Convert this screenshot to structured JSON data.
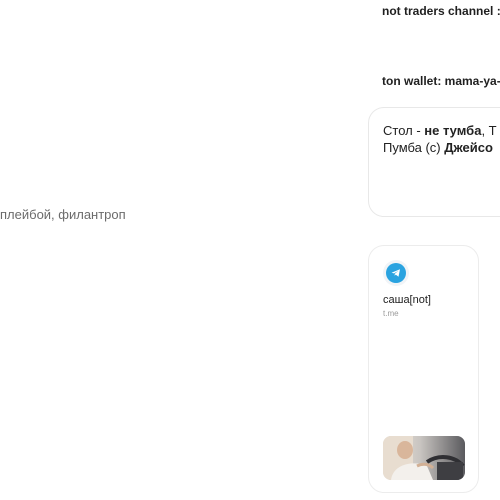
{
  "left": {
    "bio_text": "плейбой, филантроп"
  },
  "right": {
    "line_1": "not traders channel :",
    "line_2": "ton wallet: mama-ya-",
    "quote": {
      "l1_a": "Стол - ",
      "l1_b": "не тумба",
      "l1_c": ", Т",
      "l2_a": "Пумба (с) ",
      "l2_b": "Джейсо"
    },
    "link_card": {
      "icon": "telegram-icon",
      "title": "саша[not]",
      "domain": "t.me",
      "thumbnail": "person-in-car-photo"
    }
  },
  "colors": {
    "telegram_blue": "#2aa3e0",
    "muted_text": "#6b6b6b"
  }
}
